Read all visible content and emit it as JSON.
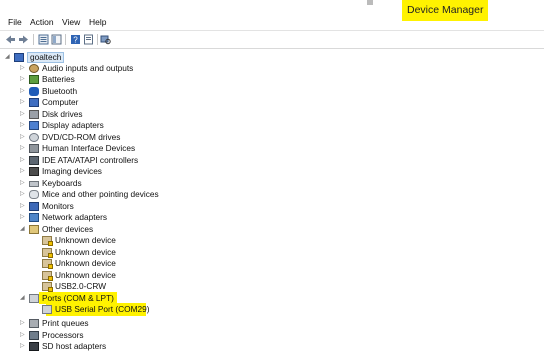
{
  "window": {
    "title": "Device Manager"
  },
  "menu": {
    "file": "File",
    "action": "Action",
    "view": "View",
    "help": "Help"
  },
  "toolbar": {
    "buttons": [
      "back-arrow-icon",
      "forward-arrow-icon",
      "properties-icon",
      "show-hide-console-tree-icon",
      "help-icon",
      "scan-hardware-icon"
    ]
  },
  "tree": {
    "root": "goaltech",
    "items": [
      {
        "label": "Audio inputs and outputs",
        "icon": "audio-icon"
      },
      {
        "label": "Batteries",
        "icon": "battery-icon"
      },
      {
        "label": "Bluetooth",
        "icon": "bluetooth-icon"
      },
      {
        "label": "Computer",
        "icon": "computer-icon"
      },
      {
        "label": "Disk drives",
        "icon": "disk-drive-icon"
      },
      {
        "label": "Display adapters",
        "icon": "display-adapter-icon"
      },
      {
        "label": "DVD/CD-ROM drives",
        "icon": "dvd-icon"
      },
      {
        "label": "Human Interface Devices",
        "icon": "hid-icon"
      },
      {
        "label": "IDE ATA/ATAPI controllers",
        "icon": "ide-icon"
      },
      {
        "label": "Imaging devices",
        "icon": "camera-icon"
      },
      {
        "label": "Keyboards",
        "icon": "keyboard-icon"
      },
      {
        "label": "Mice and other pointing devices",
        "icon": "mouse-icon"
      },
      {
        "label": "Monitors",
        "icon": "monitor-icon"
      },
      {
        "label": "Network adapters",
        "icon": "network-icon"
      }
    ],
    "other_devices": {
      "label": "Other devices",
      "children": [
        "Unknown device",
        "Unknown device",
        "Unknown device",
        "Unknown device",
        "USB2.0-CRW"
      ]
    },
    "ports": {
      "label": "Ports (COM & LPT)",
      "children": [
        "USB Serial Port (COM29)"
      ]
    },
    "after": [
      {
        "label": "Print queues",
        "icon": "printer-icon"
      },
      {
        "label": "Processors",
        "icon": "processor-icon"
      },
      {
        "label": "SD host adapters",
        "icon": "sd-card-icon"
      }
    ]
  },
  "colors": {
    "highlight": "#fff200",
    "selection": "#dbe9f7"
  }
}
